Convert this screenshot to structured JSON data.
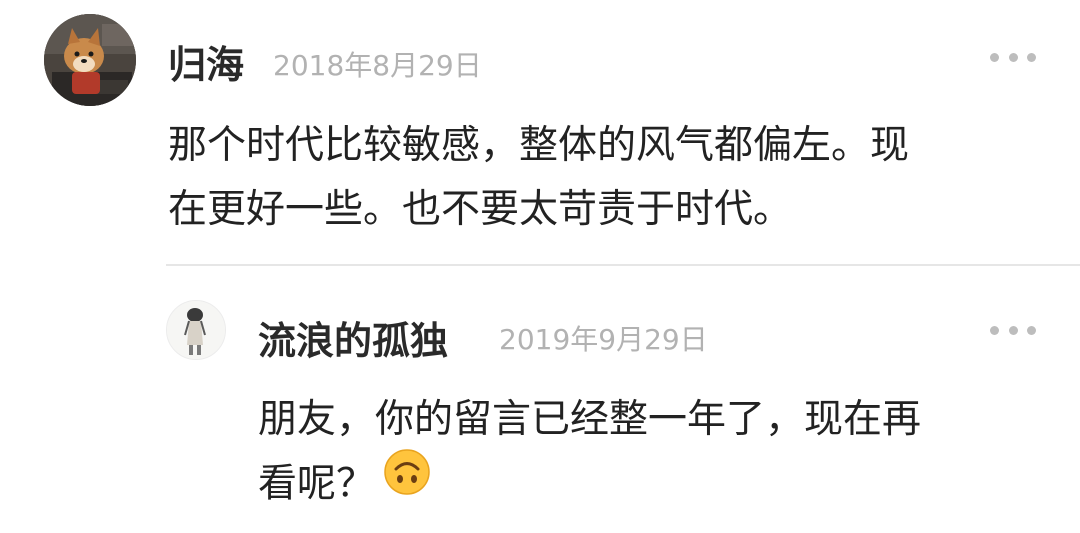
{
  "comments": [
    {
      "author": "归海",
      "date": "2018年8月29日",
      "text_line1": "那个时代比较敏感，整体的风气都偏左。现",
      "text_line2": "在更好一些。也不要太苛责于时代。",
      "avatar_icon": "shiba-dog-avatar"
    },
    {
      "author": "流浪的孤独",
      "date": "2019年9月29日",
      "text_line1": "朋友，你的留言已经整一年了，现在再",
      "text_line2": "看呢？",
      "avatar_icon": "figure-avatar",
      "emoji": "upside-down-face-emoji"
    }
  ],
  "colors": {
    "text": "#222222",
    "date": "#b2b2b2",
    "divider": "#e6e6e6",
    "dots": "#bdbdbd",
    "emoji": "#ffc43d"
  }
}
